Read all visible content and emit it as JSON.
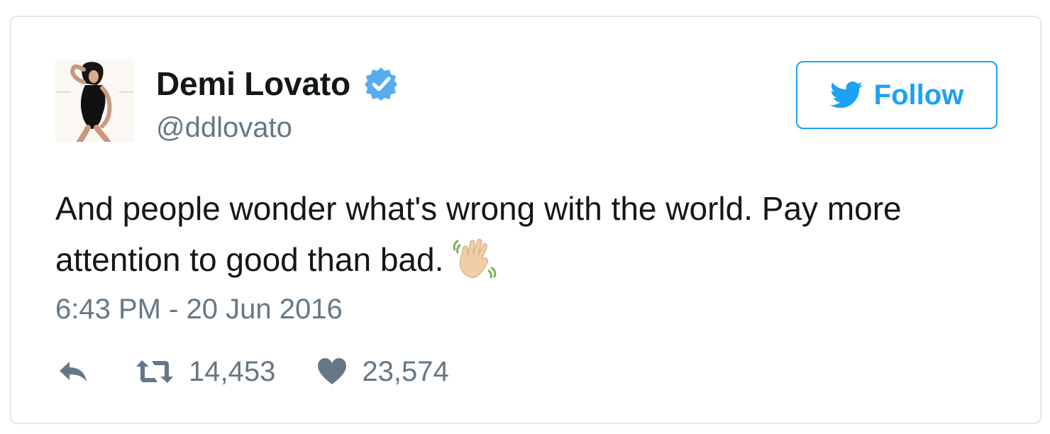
{
  "tweet": {
    "author": {
      "name": "Demi Lovato",
      "handle": "@ddlovato",
      "verified": true,
      "avatar_icon": "profile-photo"
    },
    "follow_button": {
      "label": "Follow",
      "icon": "twitter-bird-icon"
    },
    "text": "And people wonder what's wrong with the world. Pay more attention to good than bad.",
    "emoji": "waving-hand-icon",
    "timestamp": "6:43 PM - 20 Jun 2016",
    "actions": {
      "reply_icon": "reply-icon",
      "retweet_icon": "retweet-icon",
      "retweet_count": "14,453",
      "like_icon": "heart-icon",
      "like_count": "23,574"
    },
    "colors": {
      "accent": "#1da1f2",
      "verified": "#55acee",
      "text": "#14171a",
      "secondary": "#657786",
      "border": "#e1e8ed",
      "action_icon": "#657786"
    }
  }
}
